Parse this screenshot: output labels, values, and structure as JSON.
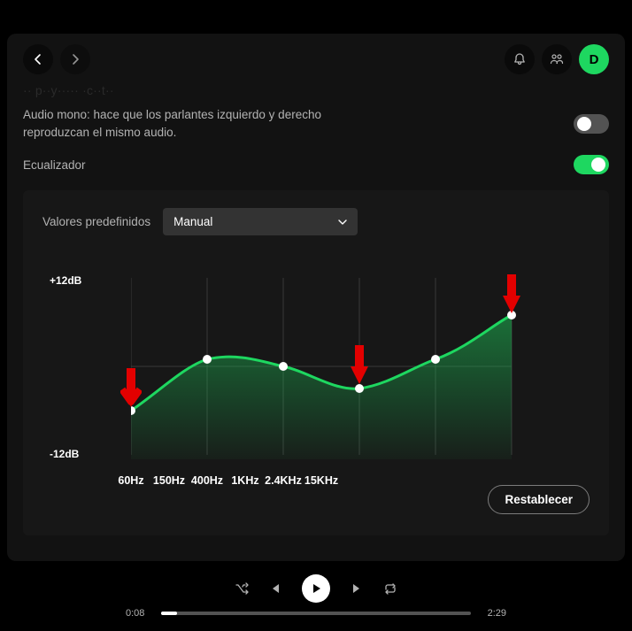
{
  "header": {
    "avatar_letter": "D"
  },
  "settings": {
    "obscured_line": "·· p··y····· ·c··t··",
    "mono_audio_text": "Audio mono: hace que los parlantes izquierdo y derecho reproduzcan el mismo audio.",
    "mono_on": false,
    "eq_label": "Ecualizador",
    "eq_on": true
  },
  "equalizer": {
    "preset_label": "Valores predefinidos",
    "preset_value": "Manual",
    "reset_label": "Restablecer",
    "y_top": "+12dB",
    "y_bot": "-12dB",
    "bands": [
      "60Hz",
      "150Hz",
      "400Hz",
      "1KHz",
      "2.4KHz",
      "15KHz"
    ]
  },
  "player": {
    "elapsed": "0:08",
    "total": "2:29",
    "progress_pct": 5
  },
  "chart_data": {
    "type": "line",
    "title": "",
    "xlabel": "",
    "ylabel": "dB",
    "ylim": [
      -12,
      12
    ],
    "categories": [
      "60Hz",
      "150Hz",
      "400Hz",
      "1KHz",
      "2.4KHz",
      "15KHz"
    ],
    "values": [
      -6,
      1,
      0,
      -3,
      1,
      7
    ],
    "annotations": [
      {
        "kind": "arrow-down",
        "x": "60Hz"
      },
      {
        "kind": "arrow-down",
        "x": "1KHz"
      },
      {
        "kind": "arrow-down",
        "x": "15KHz"
      }
    ]
  }
}
